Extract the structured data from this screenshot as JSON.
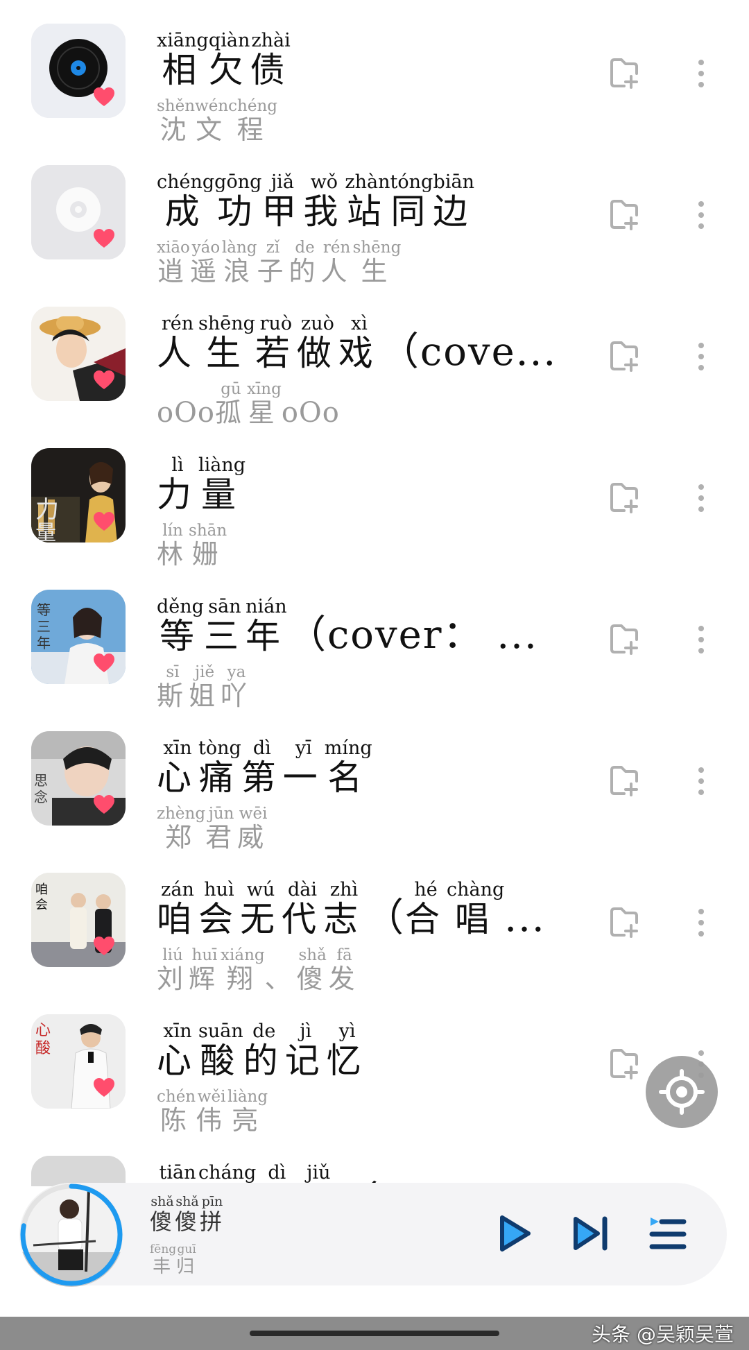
{
  "songs": [
    {
      "title": [
        [
          "相",
          "xiāng"
        ],
        [
          "欠",
          "qiàn"
        ],
        [
          "债",
          "zhài"
        ]
      ],
      "title_suffix": "",
      "artist": [
        [
          "沈",
          "shěn"
        ],
        [
          "文",
          "wén"
        ],
        [
          "程",
          "chéng"
        ]
      ],
      "artist_prefix": "",
      "artist_suffix": "",
      "cover_icon": "vinyl-record-icon"
    },
    {
      "title": [
        [
          "成",
          "chéng"
        ],
        [
          "功",
          "gōng"
        ],
        [
          "甲",
          "jiǎ"
        ],
        [
          "我",
          "wǒ"
        ],
        [
          "站",
          "zhàn"
        ],
        [
          "同",
          "tóng"
        ],
        [
          "边",
          "biān"
        ]
      ],
      "title_suffix": "",
      "artist": [
        [
          "逍",
          "xiāo"
        ],
        [
          "遥",
          "yáo"
        ],
        [
          "浪",
          "làng"
        ],
        [
          "子",
          "zǐ"
        ],
        [
          "的",
          "de"
        ],
        [
          "人",
          "rén"
        ],
        [
          "生",
          "shēng"
        ]
      ],
      "artist_prefix": "",
      "artist_suffix": "",
      "cover_icon": "disc-placeholder-icon"
    },
    {
      "title": [
        [
          "人",
          "rén"
        ],
        [
          "生",
          "shēng"
        ],
        [
          "若",
          "ruò"
        ],
        [
          "做",
          "zuò"
        ],
        [
          "戏",
          "xì"
        ]
      ],
      "title_suffix": "（cove...",
      "artist": [
        [
          "孤",
          "gū"
        ],
        [
          "星",
          "xīng"
        ]
      ],
      "artist_prefix": "oOo",
      "artist_suffix": "oOo",
      "cover_icon": "anime-portrait-cover"
    },
    {
      "title": [
        [
          "力",
          "lì"
        ],
        [
          "量",
          "liàng"
        ]
      ],
      "title_suffix": "",
      "artist": [
        [
          "林",
          "lín"
        ],
        [
          "姗",
          "shān"
        ]
      ],
      "artist_prefix": "",
      "artist_suffix": "",
      "cover_icon": "singer-city-night-cover"
    },
    {
      "title": [
        [
          "等",
          "děng"
        ],
        [
          "三",
          "sān"
        ],
        [
          "年",
          "nián"
        ]
      ],
      "title_suffix": "（cover：  ...",
      "artist": [
        [
          "斯",
          "sī"
        ],
        [
          "姐",
          "jiě"
        ],
        [
          "吖",
          "ya"
        ]
      ],
      "artist_prefix": "",
      "artist_suffix": "",
      "cover_icon": "singer-portrait-cover"
    },
    {
      "title": [
        [
          "心",
          "xīn"
        ],
        [
          "痛",
          "tòng"
        ],
        [
          "第",
          "dì"
        ],
        [
          "一",
          "yī"
        ],
        [
          "名",
          "míng"
        ]
      ],
      "title_suffix": "",
      "artist": [
        [
          "郑",
          "zhèng"
        ],
        [
          "君",
          "jūn"
        ],
        [
          "威",
          "wēi"
        ]
      ],
      "artist_prefix": "",
      "artist_suffix": "",
      "cover_icon": "singer-closeup-cover"
    },
    {
      "title": [
        [
          "咱",
          "zán"
        ],
        [
          "会",
          "huì"
        ],
        [
          "无",
          "wú"
        ],
        [
          "代",
          "dài"
        ],
        [
          "志",
          "zhì"
        ]
      ],
      "title_suffix": "（",
      "title_tail": [
        [
          "合",
          "hé"
        ],
        [
          "唱",
          "chàng"
        ]
      ],
      "title_tail_suffix": "...",
      "artist": [
        [
          "刘",
          "liú"
        ],
        [
          "辉",
          "huī"
        ],
        [
          "翔",
          "xiáng"
        ],
        [
          "、",
          ""
        ],
        [
          "傻",
          "shǎ"
        ],
        [
          "发",
          "fā"
        ]
      ],
      "artist_prefix": "",
      "artist_suffix": "",
      "cover_icon": "duet-singers-cover"
    },
    {
      "title": [
        [
          "心",
          "xīn"
        ],
        [
          "酸",
          "suān"
        ],
        [
          "的",
          "de"
        ],
        [
          "记",
          "jì"
        ],
        [
          "忆",
          "yì"
        ]
      ],
      "title_suffix": "",
      "artist": [
        [
          "陈",
          "chén"
        ],
        [
          "伟",
          "wěi"
        ],
        [
          "亮",
          "liàng"
        ]
      ],
      "artist_prefix": "",
      "artist_suffix": "",
      "cover_icon": "singer-suit-cover"
    },
    {
      "title": [
        [
          "天",
          "tiān"
        ],
        [
          "长",
          "cháng"
        ],
        [
          "地",
          "dì"
        ],
        [
          "久",
          "jiǔ"
        ]
      ],
      "title_suffix": "（",
      "artist": [],
      "artist_prefix": "",
      "artist_suffix": "",
      "cover_icon": "partial-cover"
    }
  ],
  "row_icons": {
    "favorite": "heart-icon",
    "add": "add-to-playlist-icon",
    "more": "more-vertical-icon"
  },
  "now_playing": {
    "title": [
      [
        "傻",
        "shǎ"
      ],
      [
        "傻",
        "shǎ"
      ],
      [
        "拼",
        "pīn"
      ]
    ],
    "artist": [
      [
        "丰",
        "fēng"
      ],
      [
        "归",
        "guī"
      ]
    ],
    "progress_fraction": 0.78,
    "controls": [
      "play-icon",
      "next-icon",
      "playlist-icon"
    ]
  },
  "fab_icon": "locate-current-icon",
  "watermark": "头条 @吴颖吴萱",
  "colors": {
    "heart": "#ff4d6d",
    "progress": "#1e9af0",
    "icon": "#b0b0b0",
    "control": "#0f3b6e",
    "control_accent": "#36a7f5"
  }
}
